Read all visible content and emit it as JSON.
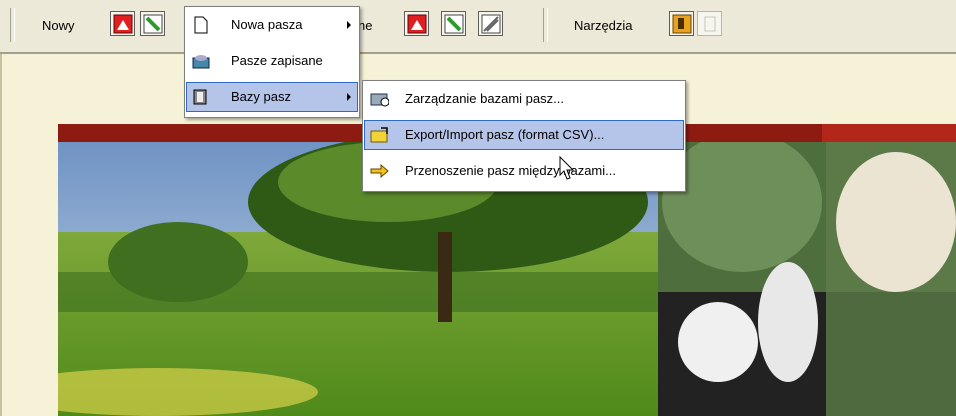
{
  "toolbar": {
    "group1_label": "Nowy",
    "group2_label": "ne",
    "group3_label": "Narzędzia"
  },
  "menu": {
    "items": [
      {
        "label": "Nowa pasza",
        "icon": "document-icon",
        "has_submenu": true
      },
      {
        "label": "Pasze zapisane",
        "icon": "open-folder-icon",
        "has_submenu": false
      },
      {
        "label": "Bazy pasz",
        "icon": "database-icon",
        "has_submenu": true,
        "selected": true
      }
    ]
  },
  "submenu": {
    "items": [
      {
        "label": "Zarządzanie bazami pasz...",
        "icon": "database-manage-icon"
      },
      {
        "label": "Export/Import pasz (format CSV)...",
        "icon": "folder-export-icon",
        "selected": true
      },
      {
        "label": "Przenoszenie pasz między bazami...",
        "icon": "transfer-arrow-icon"
      }
    ]
  },
  "colors": {
    "toolbar_bg": "#ece9d8",
    "menu_highlight": "#b5c4e9",
    "content_bg": "#f6f2d7",
    "banner_red": "#8e1b12"
  }
}
